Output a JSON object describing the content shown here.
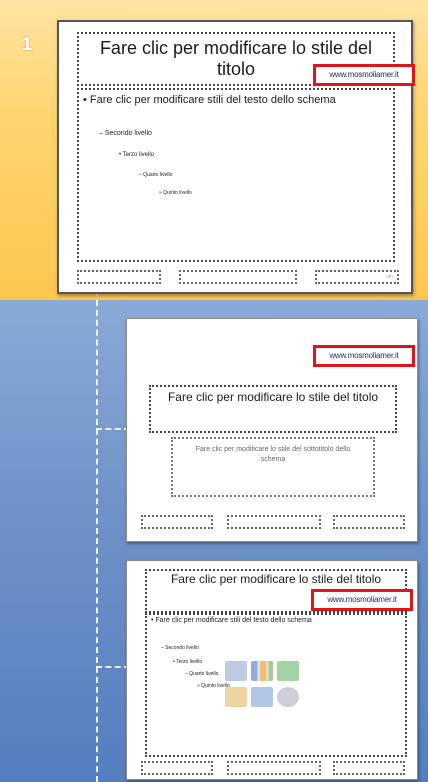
{
  "slide_number": "1",
  "logo_text": "www.mosmoliamer.it",
  "master": {
    "title": "Fare clic per modificare lo stile del titolo",
    "body_l1": "Fare clic per modificare stili del testo dello schema",
    "body_l2": "Secondo livello",
    "body_l3": "Terzo livello",
    "body_l4": "Quarto livello",
    "body_l5": "Quinto livello",
    "footer_date": "",
    "footer_center": "",
    "footer_num": "‹n›"
  },
  "title_layout": {
    "title": "Fare clic per modificare lo stile del titolo",
    "subtitle": "Fare clic per modificare lo stile del sottotitolo dello schema",
    "footer_date": "",
    "footer_center": "",
    "footer_num": ""
  },
  "content_layout": {
    "title": "Fare clic per modificare lo stile del titolo",
    "body_l1": "Fare clic per modificare stili del testo dello schema",
    "body_l2": "Secondo livello",
    "body_l3": "Terzo livello",
    "body_l4": "Quarto livello",
    "body_l5": "Quinto livello"
  }
}
